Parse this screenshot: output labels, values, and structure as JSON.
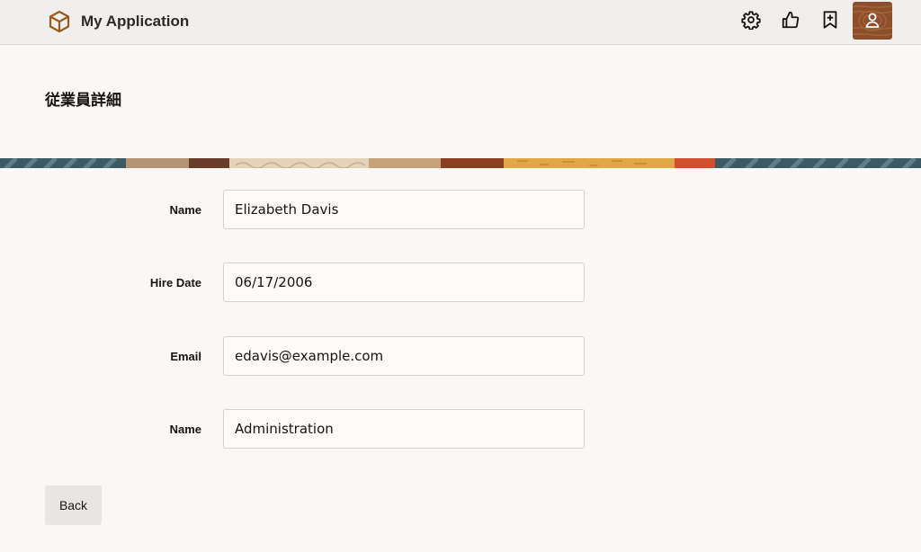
{
  "header": {
    "app_title": "My Application",
    "icons": [
      "settings-icon",
      "thumbs-up-icon",
      "bookmark-add-icon",
      "user-avatar-icon"
    ],
    "accent_color": "#9a5b1e"
  },
  "page": {
    "title": "従業員詳細"
  },
  "form": {
    "fields": [
      {
        "label": "Name",
        "value": "Elizabeth Davis"
      },
      {
        "label": "Hire Date",
        "value": "06/17/2006"
      },
      {
        "label": "Email",
        "value": "edavis@example.com"
      },
      {
        "label": "Name",
        "value": "Administration"
      }
    ]
  },
  "actions": {
    "back_label": "Back"
  }
}
